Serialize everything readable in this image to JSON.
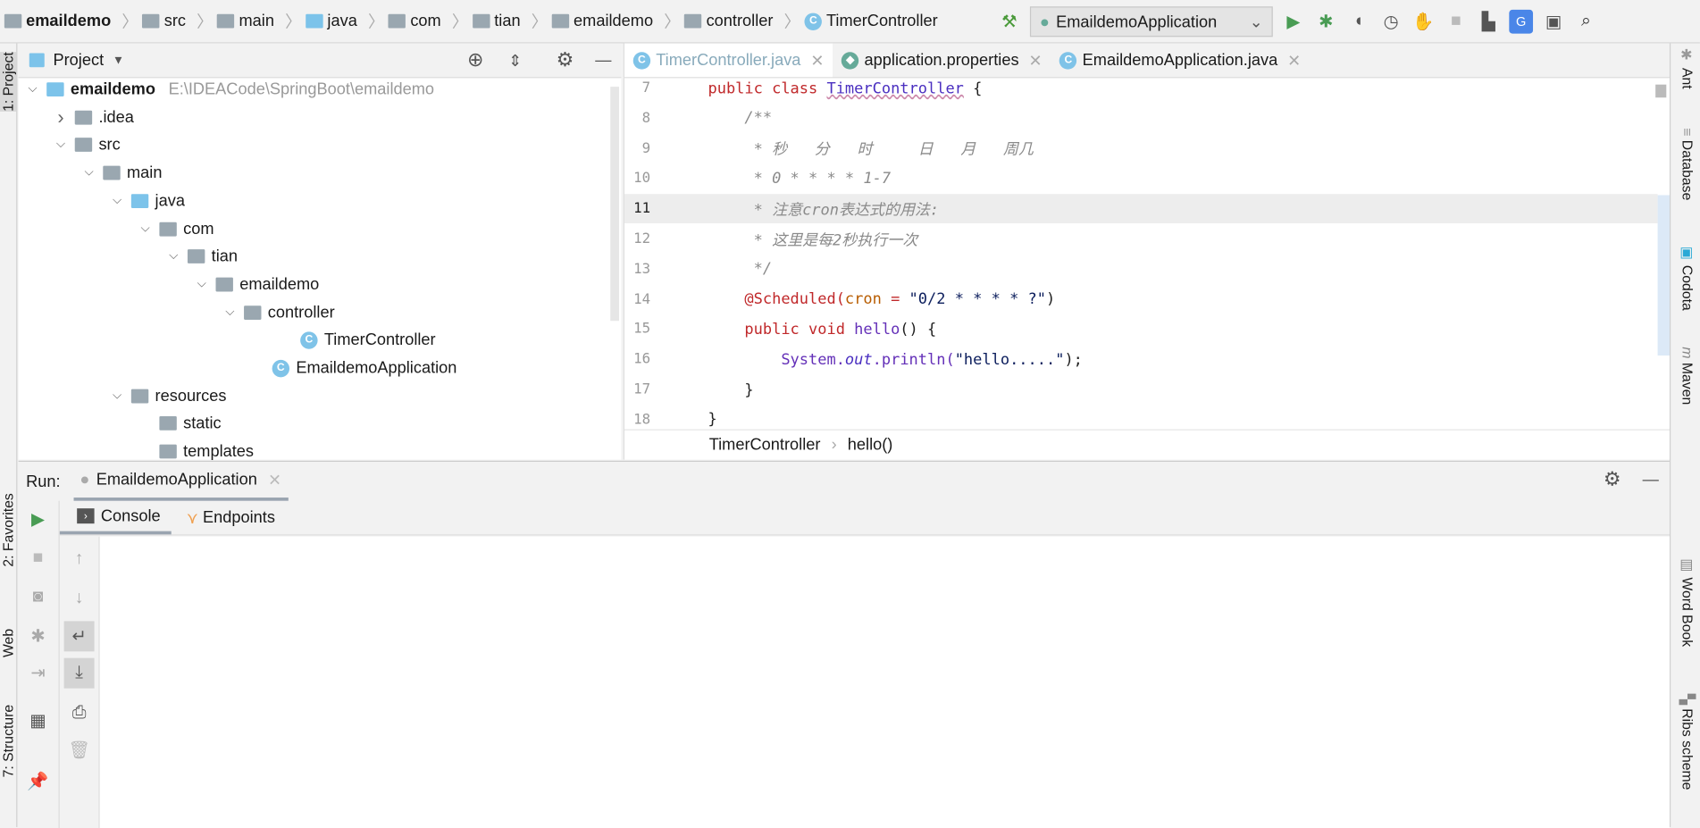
{
  "navbar": {
    "breadcrumbs": [
      "emaildemo",
      "src",
      "main",
      "java",
      "com",
      "tian",
      "emaildemo",
      "controller",
      "TimerController"
    ],
    "run_config": "EmaildemoApplication"
  },
  "project": {
    "title": "Project",
    "tree": [
      {
        "label": "emaildemo",
        "path": "E:\\IDEACode\\SpringBoot\\emaildemo",
        "depth": 0,
        "expanded": true,
        "icon": "module-folder",
        "bold": true
      },
      {
        "label": ".idea",
        "depth": 1,
        "expanded": false,
        "icon": "folder"
      },
      {
        "label": "src",
        "depth": 1,
        "expanded": true,
        "icon": "folder"
      },
      {
        "label": "main",
        "depth": 2,
        "expanded": true,
        "icon": "folder"
      },
      {
        "label": "java",
        "depth": 3,
        "expanded": true,
        "icon": "source-folder"
      },
      {
        "label": "com",
        "depth": 4,
        "expanded": true,
        "icon": "package"
      },
      {
        "label": "tian",
        "depth": 5,
        "expanded": true,
        "icon": "package"
      },
      {
        "label": "emaildemo",
        "depth": 6,
        "expanded": true,
        "icon": "package"
      },
      {
        "label": "controller",
        "depth": 7,
        "expanded": true,
        "icon": "package"
      },
      {
        "label": "TimerController",
        "depth": 9,
        "icon": "class"
      },
      {
        "label": "EmaildemoApplication",
        "depth": 8,
        "icon": "spring-class"
      },
      {
        "label": "resources",
        "depth": 3,
        "expanded": true,
        "icon": "resources-folder"
      },
      {
        "label": "static",
        "depth": 4,
        "icon": "folder"
      },
      {
        "label": "templates",
        "depth": 4,
        "icon": "folder"
      }
    ]
  },
  "editor": {
    "tabs": [
      {
        "label": "TimerController.java",
        "active": true
      },
      {
        "label": "application.properties"
      },
      {
        "label": "EmaildemoApplication.java"
      }
    ],
    "lines": [
      {
        "n": "7",
        "tokens": [
          [
            "public class ",
            "k"
          ],
          [
            "TimerController",
            "t"
          ],
          [
            " {",
            "p"
          ]
        ]
      },
      {
        "n": "8",
        "tokens": [
          [
            "    /**",
            "c"
          ]
        ]
      },
      {
        "n": "9",
        "tokens": [
          [
            "     * 秒   分   时     日   月   周几",
            "c"
          ]
        ]
      },
      {
        "n": "10",
        "tokens": [
          [
            "     * 0 * * * * 1-7",
            "c"
          ]
        ]
      },
      {
        "n": "11",
        "tokens": [
          [
            "     * 注意cron表达式的用法:",
            "c"
          ]
        ],
        "current": true
      },
      {
        "n": "12",
        "tokens": [
          [
            "     * 这里是每2秒执行一次",
            "c"
          ]
        ]
      },
      {
        "n": "13",
        "tokens": [
          [
            "     */",
            "c"
          ]
        ]
      },
      {
        "n": "14",
        "tokens": [
          [
            "    @Scheduled(",
            "k"
          ],
          [
            "cron",
            "a"
          ],
          [
            " = ",
            "k"
          ],
          [
            "\"0/2 * * * * ?\"",
            "s"
          ],
          [
            ")",
            "p"
          ]
        ]
      },
      {
        "n": "15",
        "tokens": [
          [
            "    public void ",
            "k"
          ],
          [
            "hello",
            "m"
          ],
          [
            "() {",
            "p"
          ]
        ]
      },
      {
        "n": "16",
        "tokens": [
          [
            "        System.",
            "m"
          ],
          [
            "out",
            "it"
          ],
          [
            ".println(",
            "m"
          ],
          [
            "\"hello.....\"",
            "s"
          ],
          [
            ");",
            "p"
          ]
        ]
      },
      {
        "n": "17",
        "tokens": [
          [
            "    }",
            "p"
          ]
        ]
      },
      {
        "n": "18",
        "tokens": [
          [
            "}",
            "p"
          ]
        ]
      }
    ],
    "breadcrumb": [
      "TimerController",
      "hello()"
    ]
  },
  "run": {
    "label": "Run:",
    "config_tab": "EmaildemoApplication",
    "tabs": [
      "Console",
      "Endpoints"
    ]
  },
  "left_stripe": [
    "1: Project",
    "2: Favorites",
    "Web",
    "7: Structure"
  ],
  "right_stripe": [
    "Ant",
    "Database",
    "Codota",
    "Maven",
    "Word Book",
    "Ribs scheme"
  ],
  "colors": {
    "run_green": "#499c54",
    "accent_blue": "#7fc3e8",
    "endpoints_orange": "#f0a050"
  }
}
